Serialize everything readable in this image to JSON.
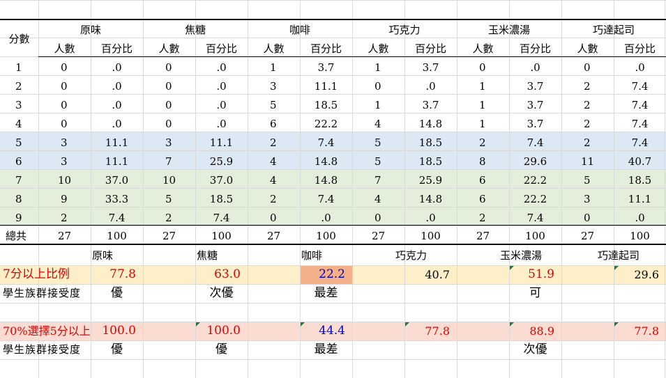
{
  "table1": {
    "row_header": "分數",
    "flavors": [
      "原味",
      "焦糖",
      "咖啡",
      "巧克力",
      "玉米濃湯",
      "巧達起司"
    ],
    "sub_headers": [
      "人數",
      "百分比"
    ],
    "rows": [
      {
        "score": "1",
        "cells": [
          "0",
          ".0",
          "0",
          ".0",
          "1",
          "3.7",
          "1",
          "3.7",
          "0",
          ".0",
          "0",
          ".0"
        ]
      },
      {
        "score": "2",
        "cells": [
          "0",
          ".0",
          "0",
          ".0",
          "3",
          "11.1",
          "0",
          ".0",
          "1",
          "3.7",
          "2",
          "7.4"
        ]
      },
      {
        "score": "3",
        "cells": [
          "0",
          ".0",
          "0",
          ".0",
          "5",
          "18.5",
          "1",
          "3.7",
          "1",
          "3.7",
          "2",
          "7.4"
        ]
      },
      {
        "score": "4",
        "cells": [
          "0",
          ".0",
          "0",
          ".0",
          "6",
          "22.2",
          "4",
          "14.8",
          "1",
          "3.7",
          "2",
          "7.4"
        ]
      },
      {
        "score": "5",
        "cells": [
          "3",
          "11.1",
          "3",
          "11.1",
          "2",
          "7.4",
          "5",
          "18.5",
          "2",
          "7.4",
          "2",
          "7.4"
        ]
      },
      {
        "score": "6",
        "cells": [
          "3",
          "11.1",
          "7",
          "25.9",
          "4",
          "14.8",
          "5",
          "18.5",
          "8",
          "29.6",
          "11",
          "40.7"
        ]
      },
      {
        "score": "7",
        "cells": [
          "10",
          "37.0",
          "10",
          "37.0",
          "4",
          "14.8",
          "7",
          "25.9",
          "6",
          "22.2",
          "5",
          "18.5"
        ]
      },
      {
        "score": "8",
        "cells": [
          "9",
          "33.3",
          "5",
          "18.5",
          "2",
          "7.4",
          "4",
          "14.8",
          "6",
          "22.2",
          "3",
          "11.1"
        ]
      },
      {
        "score": "9",
        "cells": [
          "2",
          "7.4",
          "2",
          "7.4",
          "0",
          ".0",
          "0",
          ".0",
          "2",
          "7.4",
          "0",
          ".0"
        ]
      }
    ],
    "total": {
      "label": "總共",
      "cells": [
        "27",
        "100",
        "27",
        "100",
        "27",
        "100",
        "27",
        "100",
        "27",
        "100",
        "27",
        "100"
      ]
    }
  },
  "table2": {
    "flavors": [
      "原味",
      "焦糖",
      "咖啡",
      "巧克力",
      "玉米濃湯",
      "巧達起司"
    ],
    "row1": {
      "label": "7分以上比例",
      "values": [
        "77.8",
        "63.0",
        "22.2",
        "40.7",
        "51.9",
        "29.6"
      ]
    },
    "rating1": {
      "label": "學生族群接受度",
      "values": [
        "優",
        "次優",
        "最差",
        "",
        "可",
        ""
      ]
    },
    "row2": {
      "label": "70%選擇5分以上",
      "values": [
        "100.0",
        "100.0",
        "44.4",
        "77.8",
        "88.9",
        "77.8"
      ]
    },
    "rating2": {
      "label": "學生族群接受度",
      "values": [
        "優",
        "優",
        "最差",
        "",
        "次優",
        ""
      ]
    }
  },
  "colors": {
    "blue_band": "#dce9f5",
    "green_band": "#e3efda",
    "yellow_band": "#fdf0c9",
    "pink_band": "#fbdcd2",
    "coffee_highlight": "#f4b088",
    "red_text": "#e00000",
    "blue_text": "#0000cc",
    "comment_marker": "#1f7a3a"
  }
}
